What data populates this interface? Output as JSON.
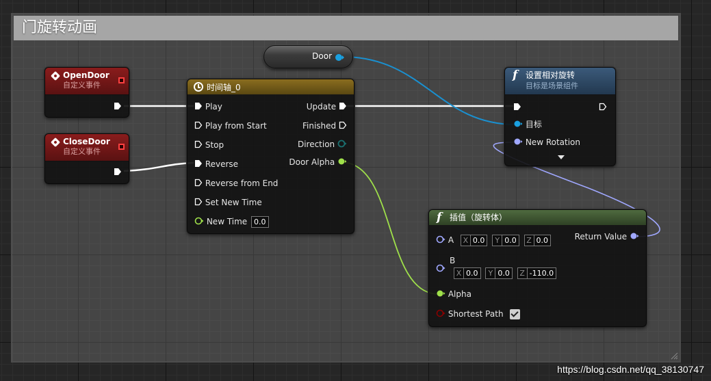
{
  "comment": {
    "title": "门旋转动画"
  },
  "variable_node": {
    "label": "Door"
  },
  "open_door": {
    "title": "OpenDoor",
    "subtitle": "自定义事件"
  },
  "close_door": {
    "title": "CloseDoor",
    "subtitle": "自定义事件"
  },
  "timeline": {
    "title": "时间轴_0",
    "inputs": [
      "Play",
      "Play from Start",
      "Stop",
      "Reverse",
      "Reverse from End",
      "Set New Time"
    ],
    "new_time_label": "New Time",
    "new_time_value": "0.0",
    "outputs": {
      "update": "Update",
      "finished": "Finished",
      "direction": "Direction",
      "door_alpha": "Door Alpha"
    }
  },
  "set_rotation": {
    "title": "设置相对旋转",
    "subtitle": "目标是场景组件",
    "target_label": "目标",
    "new_rotation_label": "New Rotation"
  },
  "lerp": {
    "title": "插值（旋转体）",
    "a_label": "A",
    "a": {
      "x_lbl": "X",
      "x": "0.0",
      "y_lbl": "Y",
      "y": "0.0",
      "z_lbl": "Z",
      "z": "0.0"
    },
    "b_label": "B",
    "b": {
      "x_lbl": "X",
      "x": "0.0",
      "y_lbl": "Y",
      "y": "0.0",
      "z_lbl": "Z",
      "z": "-110.0"
    },
    "alpha_label": "Alpha",
    "shortest_path_label": "Shortest Path",
    "shortest_path_checked": true,
    "return_label": "Return Value"
  },
  "watermark": "https://blog.csdn.net/qq_38130747",
  "colors": {
    "exec": "#ffffff",
    "object_pin": "#1aa0e0",
    "rotator_pin": "#a0a8ff",
    "float_pin": "#9fe04a",
    "bool_pin": "#8a0000",
    "direction_pin": "#1a6e6e",
    "event_header": "#8a1c1c",
    "timeline_header": "#8a6d1f",
    "function_header_blue": "#3b5a7a",
    "function_header_green": "#4f6a3f"
  }
}
